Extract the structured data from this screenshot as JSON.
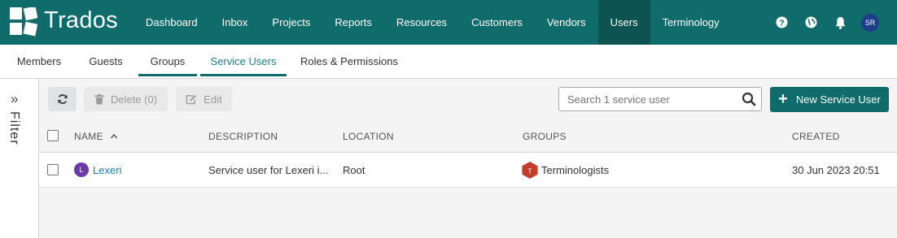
{
  "brand": {
    "name": "Trados"
  },
  "nav": {
    "items": [
      {
        "label": "Dashboard"
      },
      {
        "label": "Inbox"
      },
      {
        "label": "Projects"
      },
      {
        "label": "Reports"
      },
      {
        "label": "Resources"
      },
      {
        "label": "Customers"
      },
      {
        "label": "Vendors"
      },
      {
        "label": "Users",
        "active": true
      },
      {
        "label": "Terminology"
      }
    ],
    "user_initials": "SR"
  },
  "subtabs": [
    {
      "label": "Members"
    },
    {
      "label": "Guests"
    },
    {
      "label": "Groups"
    },
    {
      "label": "Service Users",
      "active": true
    },
    {
      "label": "Roles & Permissions"
    }
  ],
  "filter": {
    "label": "Filter"
  },
  "toolbar": {
    "delete_label": "Delete (0)",
    "edit_label": "Edit",
    "search_placeholder": "Search 1 service user",
    "new_label": "New Service User"
  },
  "table": {
    "columns": {
      "name": "NAME",
      "description": "DESCRIPTION",
      "location": "LOCATION",
      "groups": "GROUPS",
      "created": "CREATED"
    },
    "rows": [
      {
        "avatar": "L",
        "name": "Lexeri",
        "description": "Service user for Lexeri i...",
        "location": "Root",
        "group_initial": "T",
        "group": "Terminologists",
        "created": "30 Jun 2023 20:51"
      }
    ]
  },
  "colors": {
    "header_bg": "#106c6a",
    "active_nav_bg": "#0c5351",
    "link": "#1a7fb5",
    "user_avatar": "#6b3aa8",
    "group_badge": "#c33d2a",
    "top_avatar": "#1d3f8a"
  }
}
